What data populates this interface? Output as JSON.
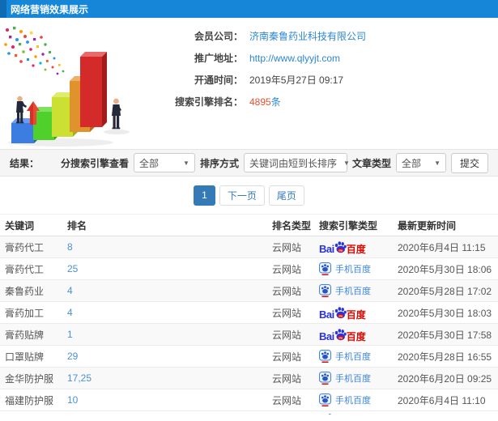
{
  "header": {
    "title": "网络营销效果展示"
  },
  "info": {
    "company_label": "会员公司：",
    "company_value": "济南秦鲁药业科技有限公司",
    "url_label": "推广地址：",
    "url_value": "http://www.qlyyjt.com",
    "open_time_label": "开通时间：",
    "open_time_value": "2019年5月27日 09:17",
    "rank_label": "搜索引擎排名：",
    "rank_count": "4895",
    "rank_unit": "条"
  },
  "filters": {
    "result_label": "结果：",
    "engine_label": "分搜索引擎查看",
    "engine_value": "全部",
    "sort_label": "排序方式",
    "sort_value": "关键词由短到长排序",
    "article_label": "文章类型",
    "article_value": "全部",
    "submit_label": "提交"
  },
  "pagination": {
    "current": "1",
    "next": "下一页",
    "last": "尾页"
  },
  "table": {
    "headers": {
      "keyword": "关键词",
      "rank": "排名",
      "rank_type": "排名类型",
      "engine": "搜索引擎类型",
      "updated": "最新更新时间"
    },
    "baidu_pc": {
      "bai": "Bai",
      "du": "du",
      "cn": "百度"
    },
    "baidu_mobile": "手机百度",
    "rows": [
      {
        "keyword": "膏药代工",
        "rank": "8",
        "rank_type": "云网站",
        "updated": "2020年6月4日 11:15"
      },
      {
        "keyword": "膏药代工",
        "rank": "25",
        "rank_type": "云网站",
        "updated": "2020年5月30日 18:06"
      },
      {
        "keyword": "秦鲁药业",
        "rank": "4",
        "rank_type": "云网站",
        "updated": "2020年5月28日 17:02"
      },
      {
        "keyword": "膏药加工",
        "rank": "4",
        "rank_type": "云网站",
        "updated": "2020年5月30日 18:03"
      },
      {
        "keyword": "膏药贴牌",
        "rank": "1",
        "rank_type": "云网站",
        "updated": "2020年5月30日 17:58"
      },
      {
        "keyword": "口罩贴牌",
        "rank": "29",
        "rank_type": "云网站",
        "updated": "2020年5月28日 16:55"
      },
      {
        "keyword": "金华防护服",
        "rank": "17,25",
        "rank_type": "云网站",
        "updated": "2020年6月20日 09:25"
      },
      {
        "keyword": "福建防护服",
        "rank": "10",
        "rank_type": "云网站",
        "updated": "2020年6月4日 11:10"
      }
    ]
  },
  "colors": {
    "header_blue": "#1687d8",
    "link_blue": "#2b87d3",
    "highlight_red": "#e8502f",
    "baidu_blue": "#2932e1",
    "baidu_red": "#e10601",
    "pagination_active": "#337ab7"
  }
}
